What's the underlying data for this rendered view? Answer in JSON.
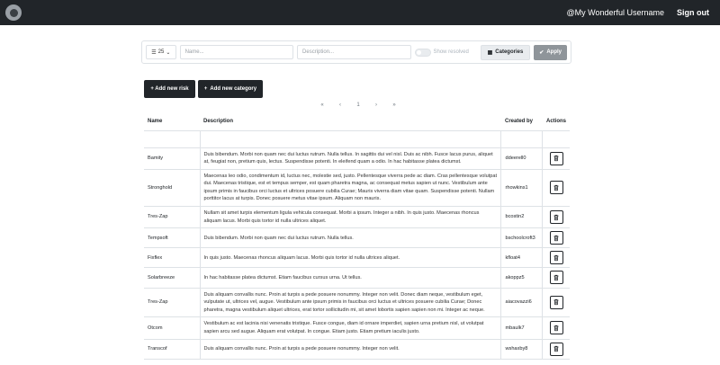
{
  "navbar": {
    "username": "@My Wonderful Username",
    "signout_label": "Sign out"
  },
  "filters": {
    "per_page": "25",
    "name_placeholder": "Name...",
    "description_placeholder": "Description...",
    "show_resolved_label": "Show resolved",
    "categories_label": "Categories",
    "apply_label": "Apply"
  },
  "actions": {
    "add_risk_label": "+ Add new risk",
    "add_category_label": "Add new category"
  },
  "pagination": {
    "first": "«",
    "prev": "‹",
    "current": "1",
    "next": "›",
    "last": "»"
  },
  "table": {
    "headers": {
      "name": "Name",
      "description": "Description",
      "created_by": "Created by",
      "actions": "Actions"
    },
    "rows": [
      {
        "name": "Bamity",
        "description": "Duis bibendum. Morbi non quam nec dui luctus rutrum. Nulla tellus. In sagittis dui vel nisl. Duis ac nibh. Fusce lacus purus, aliquet at, feugiat non, pretium quis, lectus. Suspendisse potenti. In eleifend quam a odio. In hac habitasse platea dictumst.",
        "created_by": "ddeerell0"
      },
      {
        "name": "Stronghold",
        "description": "Maecenas leo odio, condimentum id, luctus nec, molestie sed, justo. Pellentesque viverra pede ac diam. Cras pellentesque volutpat dui. Maecenas tristique, est et tempus semper, est quam pharetra magna, ac consequat metus sapien ut nunc. Vestibulum ante ipsum primis in faucibus orci luctus et ultrices posuere cubilia Curae; Mauris viverra diam vitae quam. Suspendisse potenti. Nullam porttitor lacus at turpis. Donec posuere metus vitae ipsum. Aliquam non mauris.",
        "created_by": "rhowkins1"
      },
      {
        "name": "Tres-Zap",
        "description": "Nullam sit amet turpis elementum ligula vehicula consequat. Morbi a ipsum. Integer a nibh. In quis justo. Maecenas rhoncus aliquam lacus. Morbi quis tortor id nulla ultrices aliquet.",
        "created_by": "bcostin2"
      },
      {
        "name": "Tempsoft",
        "description": "Duis bibendum. Morbi non quam nec dui luctus rutrum. Nulla tellus.",
        "created_by": "bschoolcroft3"
      },
      {
        "name": "Fixflex",
        "description": "In quis justo. Maecenas rhoncus aliquam lacus. Morbi quis tortor id nulla ultrices aliquet.",
        "created_by": "kfloat4"
      },
      {
        "name": "Solarbreeze",
        "description": "In hac habitasse platea dictumst. Etiam faucibus cursus urna. Ut tellus.",
        "created_by": "akoppz5"
      },
      {
        "name": "Tres-Zap",
        "description": "Duis aliquam convallis nunc. Proin at turpis a pede posuere nonummy. Integer non velit. Donec diam neque, vestibulum eget, vulputate ut, ultrices vel, augue. Vestibulum ante ipsum primis in faucibus orci luctus et ultrices posuere cubilia Curae; Donec pharetra, magna vestibulum aliquet ultrices, erat tortor sollicitudin mi, sit amet lobortis sapien sapien non mi. Integer ac neque.",
        "created_by": "aiacovazzi6"
      },
      {
        "name": "Otcom",
        "description": "Vestibulum ac est lacinia nisi venenatis tristique. Fusce congue, diam id ornare imperdiet, sapien urna pretium nisl, ut volutpat sapien arcu sed augue. Aliquam erat volutpat. In congue. Etiam justo. Etiam pretium iaculis justo.",
        "created_by": "mbaulk7"
      },
      {
        "name": "Transcof",
        "description": "Duis aliquam convallis nunc. Proin at turpis a pede posuere nonummy. Integer non velit.",
        "created_by": "wshaxby8"
      }
    ]
  }
}
